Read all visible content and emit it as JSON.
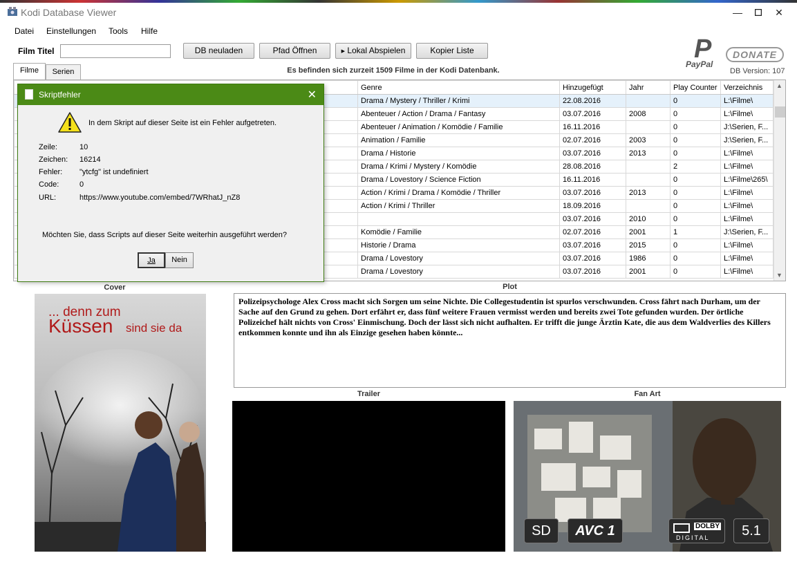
{
  "window": {
    "title": "Kodi Database Viewer",
    "min_icon": "minimize-icon",
    "max_icon": "maximize-icon",
    "close_icon": "close-icon"
  },
  "menu": [
    "Datei",
    "Einstellungen",
    "Tools",
    "Hilfe"
  ],
  "toolbar": {
    "film_label": "Film Titel",
    "film_value": "",
    "buttons": [
      "DB neuladen",
      "Pfad Öffnen",
      "Lokal Abspielen",
      "Kopier Liste"
    ]
  },
  "donate": {
    "paypal": "PayPal",
    "label": "DONATE",
    "db_version": "DB Version: 107"
  },
  "status": "Es befinden sich zurzeit 1509 Filme in der Kodi Datenbank.",
  "tabs": [
    "Filme",
    "Serien"
  ],
  "grid": {
    "columns": [
      "Genre",
      "Hinzugefügt",
      "Jahr",
      "Play Counter",
      "Verzeichnis"
    ],
    "rows": [
      [
        "Drama / Mystery / Thriller / Krimi",
        "22.08.2016",
        "",
        "0",
        "L:\\Filme\\"
      ],
      [
        "Abenteuer / Action / Drama / Fantasy",
        "03.07.2016",
        "2008",
        "0",
        "L:\\Filme\\"
      ],
      [
        "Abenteuer / Animation / Komödie / Familie",
        "16.11.2016",
        "",
        "0",
        "J:\\Serien, F..."
      ],
      [
        "Animation / Familie",
        "02.07.2016",
        "2003",
        "0",
        "J:\\Serien, F..."
      ],
      [
        "Drama / Historie",
        "03.07.2016",
        "2013",
        "0",
        "L:\\Filme\\"
      ],
      [
        "Drama / Krimi / Mystery / Komödie",
        "28.08.2016",
        "",
        "2",
        "L:\\Filme\\"
      ],
      [
        "Drama / Lovestory / Science Fiction",
        "16.11.2016",
        "",
        "0",
        "L:\\Filme\\265\\"
      ],
      [
        "Action / Krimi / Drama / Komödie / Thriller",
        "03.07.2016",
        "2013",
        "0",
        "L:\\Filme\\"
      ],
      [
        "Action / Krimi / Thriller",
        "18.09.2016",
        "",
        "0",
        "L:\\Filme\\"
      ],
      [
        "",
        "03.07.2016",
        "2010",
        "0",
        "L:\\Filme\\"
      ],
      [
        "Komödie / Familie",
        "02.07.2016",
        "2001",
        "1",
        "J:\\Serien, F..."
      ],
      [
        "Historie / Drama",
        "03.07.2016",
        "2015",
        "0",
        "L:\\Filme\\"
      ],
      [
        "Drama / Lovestory",
        "03.07.2016",
        "1986",
        "0",
        "L:\\Filme\\"
      ],
      [
        "Drama / Lovestory",
        "03.07.2016",
        "2001",
        "0",
        "L:\\Filme\\"
      ]
    ]
  },
  "dialog": {
    "title": "Skriptfehler",
    "message": "In dem Skript auf dieser Seite ist ein Fehler aufgetreten.",
    "fields": [
      {
        "label": "Zeile:",
        "value": "10"
      },
      {
        "label": "Zeichen:",
        "value": "16214"
      },
      {
        "label": "Fehler:",
        "value": "\"ytcfg\" ist undefiniert"
      },
      {
        "label": "Code:",
        "value": "0"
      },
      {
        "label": "URL:",
        "value": "https://www.youtube.com/embed/7WRhatJ_nZ8"
      }
    ],
    "question": "Möchten Sie, dass Scripts auf dieser Seite weiterhin ausgeführt werden?",
    "yes": "Ja",
    "no": "Nein"
  },
  "sections": {
    "cover": "Cover",
    "plot": "Plot",
    "trailer": "Trailer",
    "fanart": "Fan Art"
  },
  "cover_text": {
    "line1": "... denn zum",
    "line2": "Küssen",
    "line3": "sind sie da"
  },
  "plot": "Polizeipsychologe Alex Cross macht sich Sorgen um seine Nichte. Die Collegestudentin ist spurlos verschwunden. Cross fährt nach Durham, um der Sache auf den Grund zu gehen. Dort erfährt er, dass fünf weitere Frauen vermisst werden und bereits zwei Tote gefunden wurden. Der örtliche Polizeichef hält nichts von Cross' Einmischung. Doch der lässt sich nicht aufhalten. Er trifft die junge Ärztin Kate, die aus dem Waldverlies des Killers entkommen konnte und ihn als Einzige gesehen haben könnte...",
  "badges": [
    "SD",
    "AVC 1",
    "DOLBY",
    "DIGITAL",
    "5.1"
  ],
  "colors": {
    "dialog_title": "#4b8a16",
    "selected_row": "#e5f1fb"
  }
}
